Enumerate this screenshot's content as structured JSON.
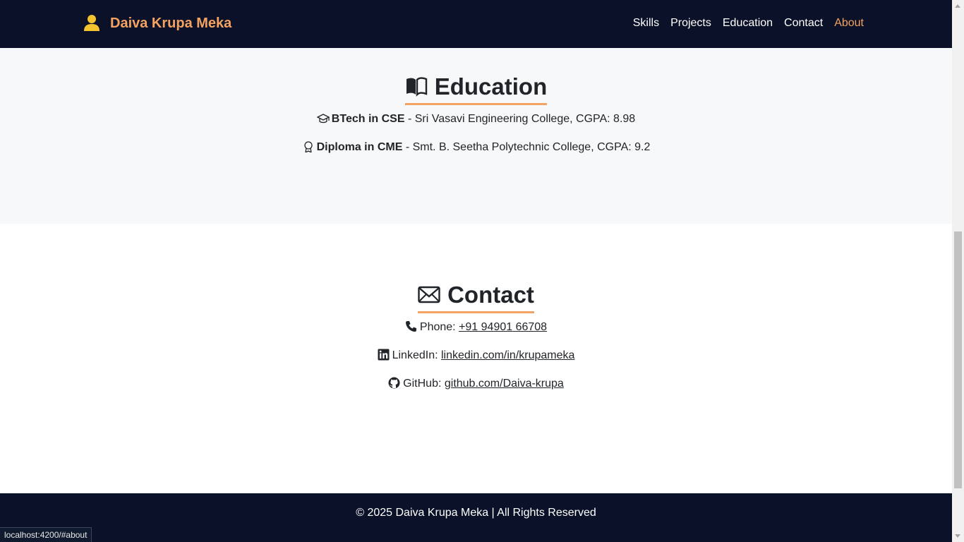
{
  "navbar": {
    "brand_icon": "user-icon",
    "brand_name": "Daiva Krupa Meka",
    "links": [
      {
        "label": "Skills"
      },
      {
        "label": "Projects"
      },
      {
        "label": "Education"
      },
      {
        "label": "Contact"
      },
      {
        "label": "About"
      }
    ],
    "active": "About"
  },
  "education": {
    "title": "Education",
    "title_icon": "open-book-icon",
    "items": [
      {
        "icon": "mortarboard-icon",
        "degree": "BTech in CSE",
        "detail": " - Sri Vasavi Engineering College, CGPA: 8.98"
      },
      {
        "icon": "award-icon",
        "degree": "Diploma in CME",
        "detail": " - Smt. B. Seetha Polytechnic College, CGPA: 9.2"
      }
    ]
  },
  "contact": {
    "title": "Contact",
    "title_icon": "envelope-icon",
    "phone": {
      "icon": "phone-icon",
      "label": "Phone: ",
      "value": "+91 94901 66708"
    },
    "linkedin": {
      "icon": "linkedin-icon",
      "label": "LinkedIn: ",
      "value": "linkedin.com/in/krupameka"
    },
    "github": {
      "icon": "github-icon",
      "label": "GitHub: ",
      "value": "github.com/Daiva-krupa"
    }
  },
  "footer": {
    "text": "© 2025 Daiva Krupa Meka | All Rights Reserved"
  },
  "status_bar": {
    "url": "localhost:4200/#about"
  },
  "colors": {
    "navbar_bg": "#0a1128",
    "accent": "#f4a261",
    "section_alt_bg": "#f6f8fa"
  }
}
